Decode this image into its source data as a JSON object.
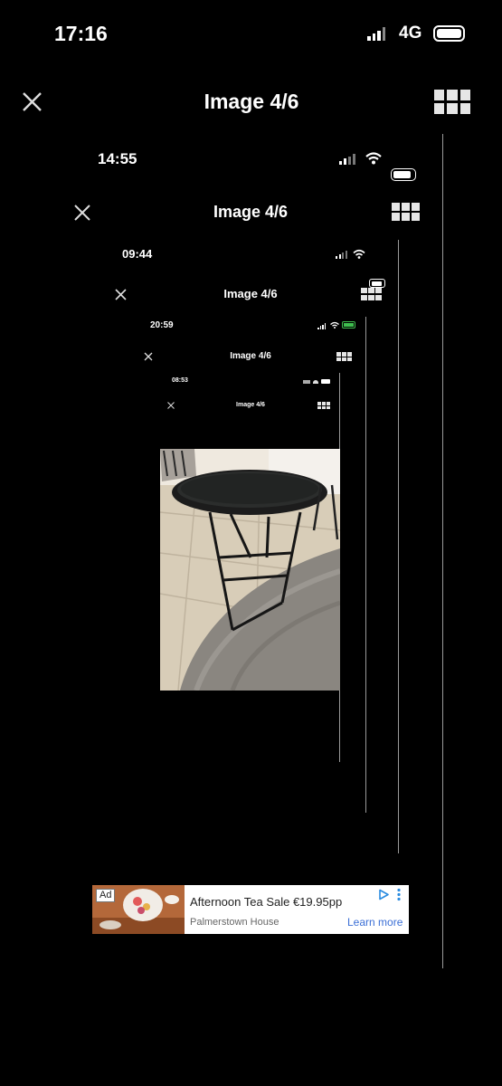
{
  "levels": [
    {
      "time": "17:16",
      "network": "4G",
      "title": "Image 4/6"
    },
    {
      "time": "14:55",
      "title": "Image 4/6"
    },
    {
      "time": "09:44",
      "title": "Image 4/6"
    },
    {
      "time": "20:59",
      "title": "Image 4/6"
    },
    {
      "time": "08:53",
      "title": "Image 4/6"
    }
  ],
  "icons": {
    "close": "close-icon",
    "grid": "grid-icon",
    "signal": "signal-icon",
    "wifi": "wifi-icon",
    "battery": "battery-icon",
    "ad_play": "adchoices-icon",
    "ad_more": "more-vertical-icon"
  },
  "photo": {
    "subject": "black round tray side table",
    "colors": {
      "floor": "#d8cdb8",
      "rug": "#8a8680",
      "table": "#1a1a1a"
    }
  },
  "ad": {
    "badge": "Ad",
    "headline": "Afternoon Tea Sale €19.95pp",
    "advertiser": "Palmerstown House",
    "cta": "Learn more",
    "colors": {
      "cta": "#3b6fd6",
      "icon": "#2a8be0"
    }
  }
}
